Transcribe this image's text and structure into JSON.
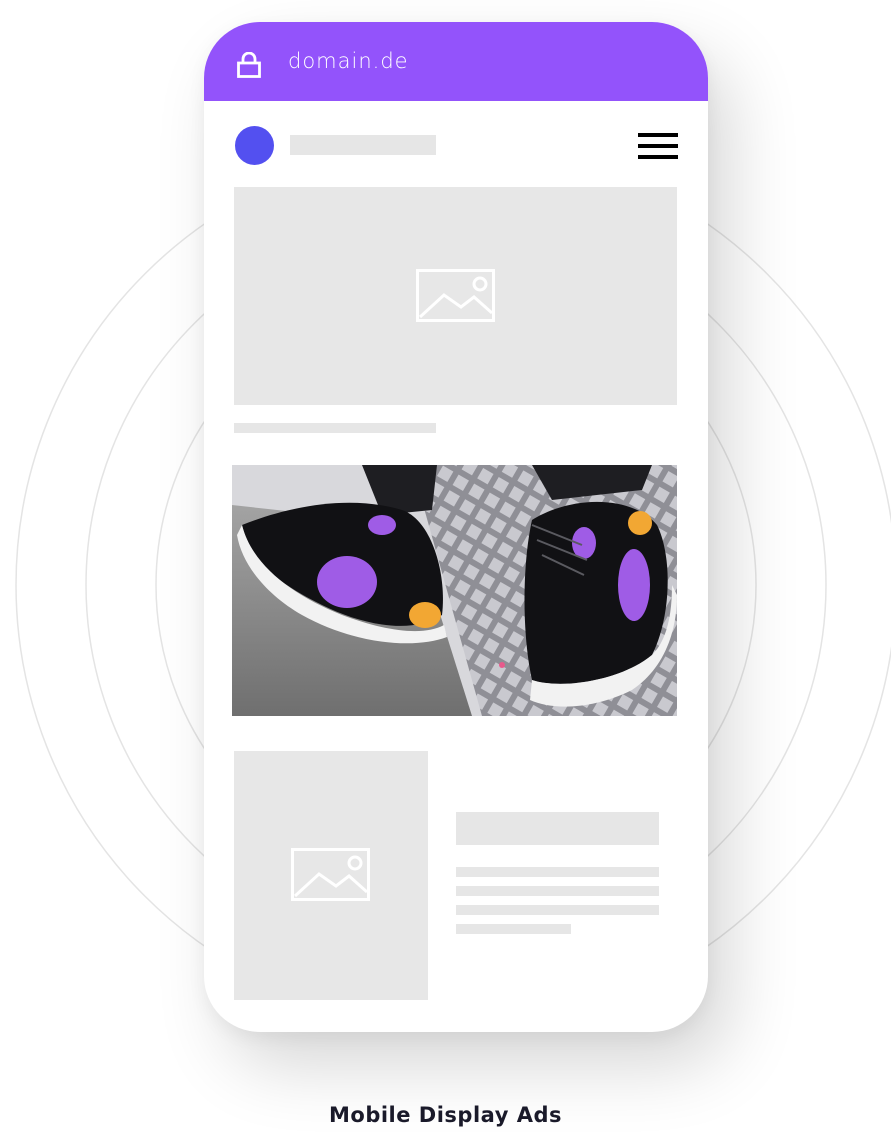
{
  "browser": {
    "url": "domain.de",
    "lock_icon": "lock-icon",
    "bar_color": "#9353fb"
  },
  "site_header": {
    "avatar_color": "#5350f0",
    "menu_icon": "hamburger-menu-icon"
  },
  "content": {
    "hero_placeholder_icon": "image-placeholder-icon",
    "ad": {
      "subject": "black sneakers with purple and orange accents",
      "accent_colors": [
        "#9f5ce6",
        "#f2a733"
      ]
    },
    "card_placeholder_icon": "image-placeholder-icon"
  },
  "caption": "Mobile Display Ads",
  "colors": {
    "placeholder": "#e7e7e7",
    "rings": "#e6e6e6"
  }
}
